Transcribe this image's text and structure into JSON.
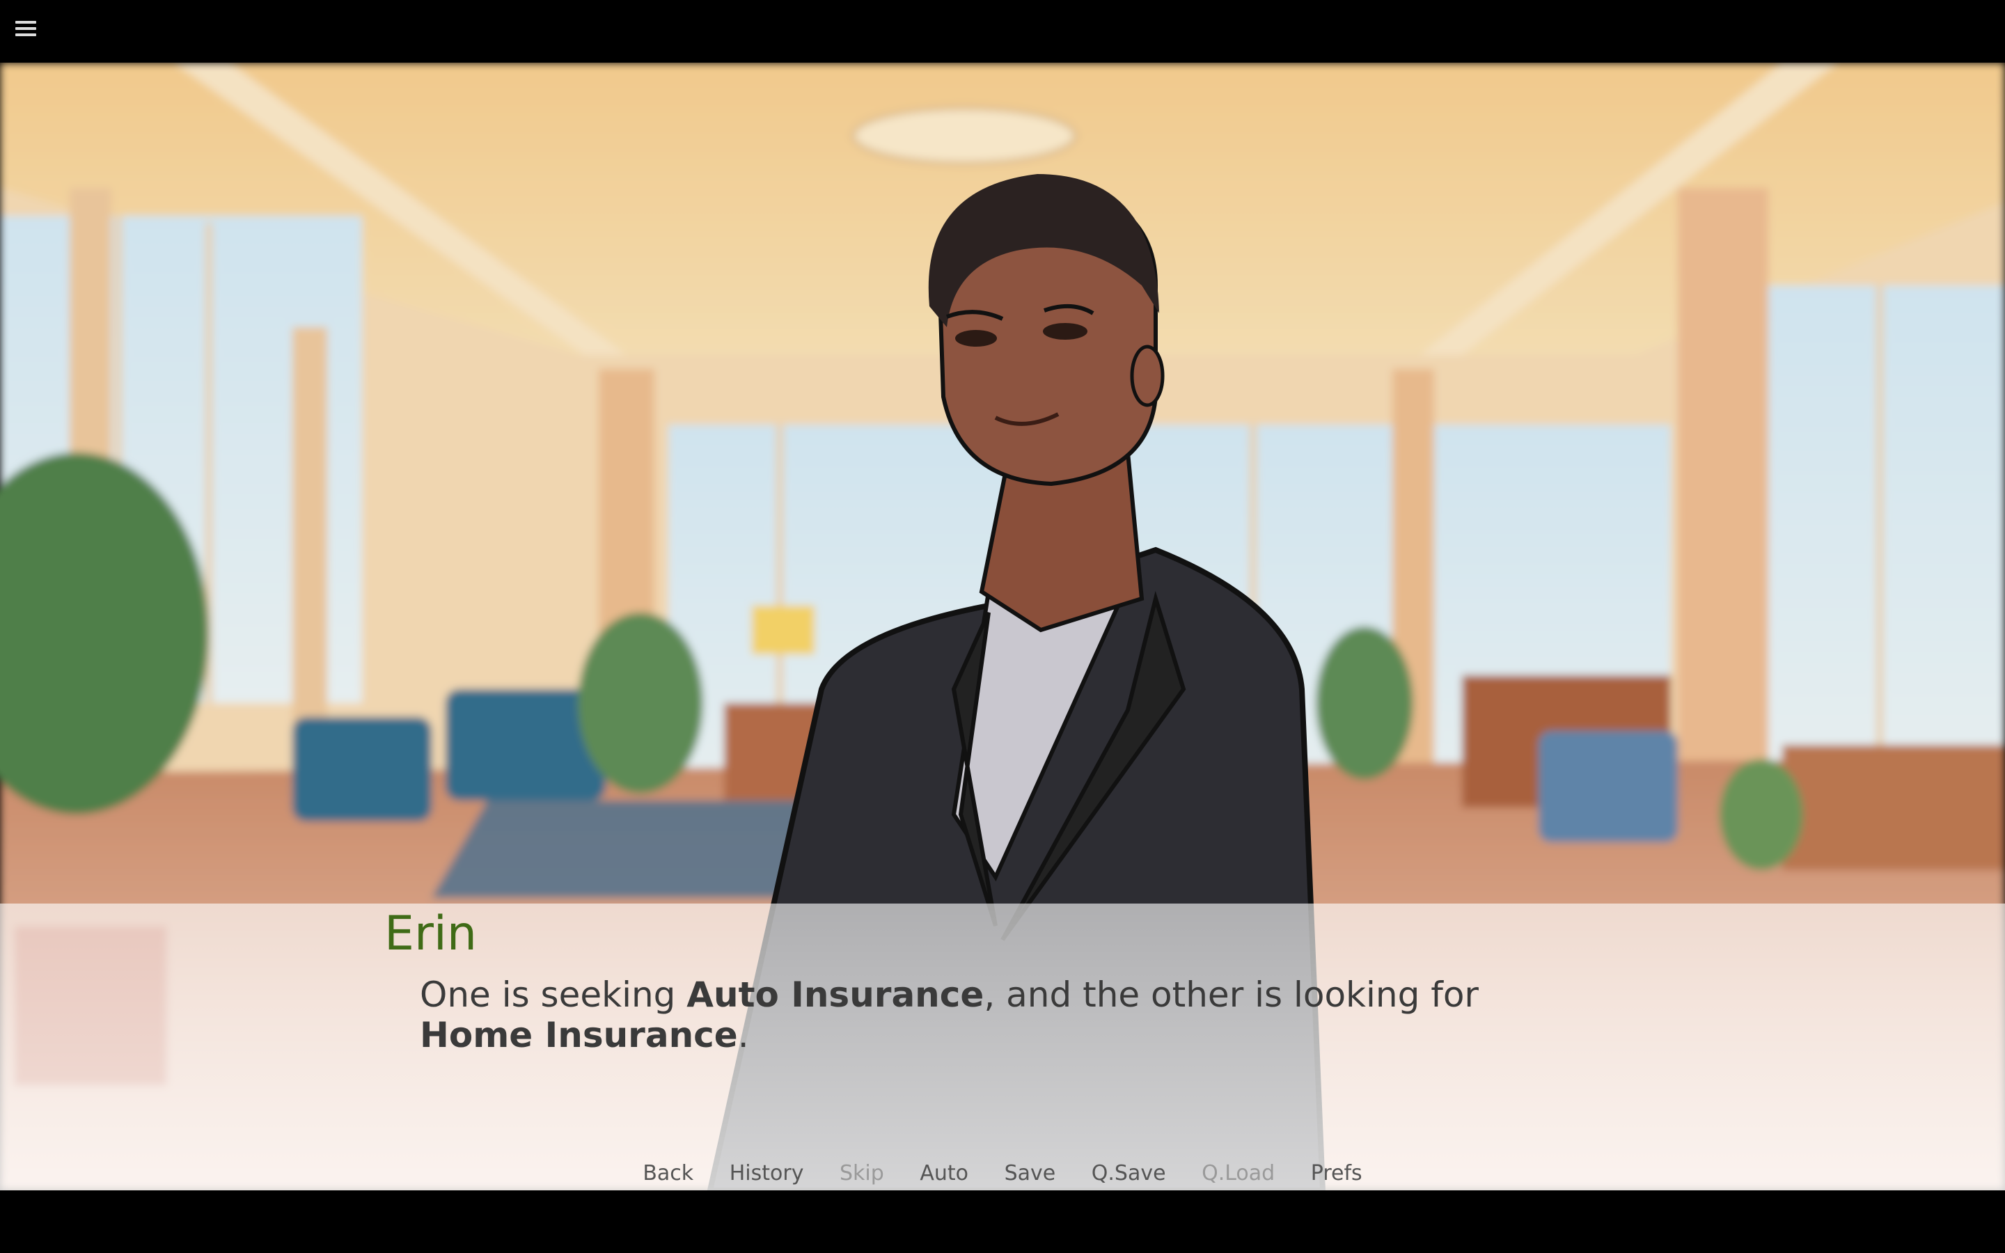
{
  "menu": {
    "icon": "hamburger-menu-icon"
  },
  "scene": {
    "background": "office-lobby",
    "character": "erin-sprite"
  },
  "dialogue": {
    "speaker": "Erin",
    "parts": [
      {
        "text": "One is seeking ",
        "bold": false
      },
      {
        "text": "Auto Insurance",
        "bold": true
      },
      {
        "text": ", and the other is looking for ",
        "bold": false
      },
      {
        "text": "Home Insurance",
        "bold": true
      },
      {
        "text": ".",
        "bold": false
      }
    ]
  },
  "quick_menu": [
    {
      "label": "Back",
      "enabled": true
    },
    {
      "label": "History",
      "enabled": true
    },
    {
      "label": "Skip",
      "enabled": false
    },
    {
      "label": "Auto",
      "enabled": true
    },
    {
      "label": "Save",
      "enabled": true
    },
    {
      "label": "Q.Save",
      "enabled": true
    },
    {
      "label": "Q.Load",
      "enabled": false
    },
    {
      "label": "Prefs",
      "enabled": true
    }
  ],
  "colors": {
    "speaker": "#3f6b16",
    "dialogue_text": "#3a3a3a",
    "menu_enabled": "#555555",
    "menu_disabled": "#9a9a9a"
  }
}
